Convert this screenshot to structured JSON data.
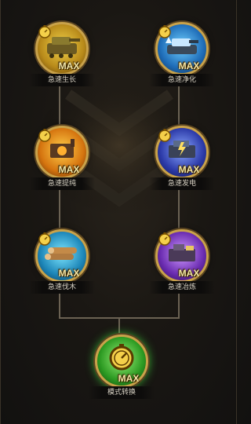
{
  "colors": {
    "ring_gold": "#c9a24a",
    "green_glow": "#3ccf3a",
    "bg": "#1a1713"
  },
  "nodes": [
    {
      "label": "急速生长",
      "badge": "MAX",
      "icon": "tank-icon",
      "theme": "yellow"
    },
    {
      "label": "急速净化",
      "badge": "MAX",
      "icon": "ice-tank-icon",
      "theme": "blue"
    },
    {
      "label": "急速提纯",
      "badge": "MAX",
      "icon": "furnace-icon",
      "theme": "orange"
    },
    {
      "label": "急速发电",
      "badge": "MAX",
      "icon": "generator-icon",
      "theme": "indigo"
    },
    {
      "label": "急速伐木",
      "badge": "MAX",
      "icon": "lumber-icon",
      "theme": "cyan"
    },
    {
      "label": "急速冶炼",
      "badge": "MAX",
      "icon": "smelter-icon",
      "theme": "purple"
    },
    {
      "label": "模式转换",
      "badge": "MAX",
      "icon": "stopwatch-icon",
      "theme": "green"
    }
  ]
}
